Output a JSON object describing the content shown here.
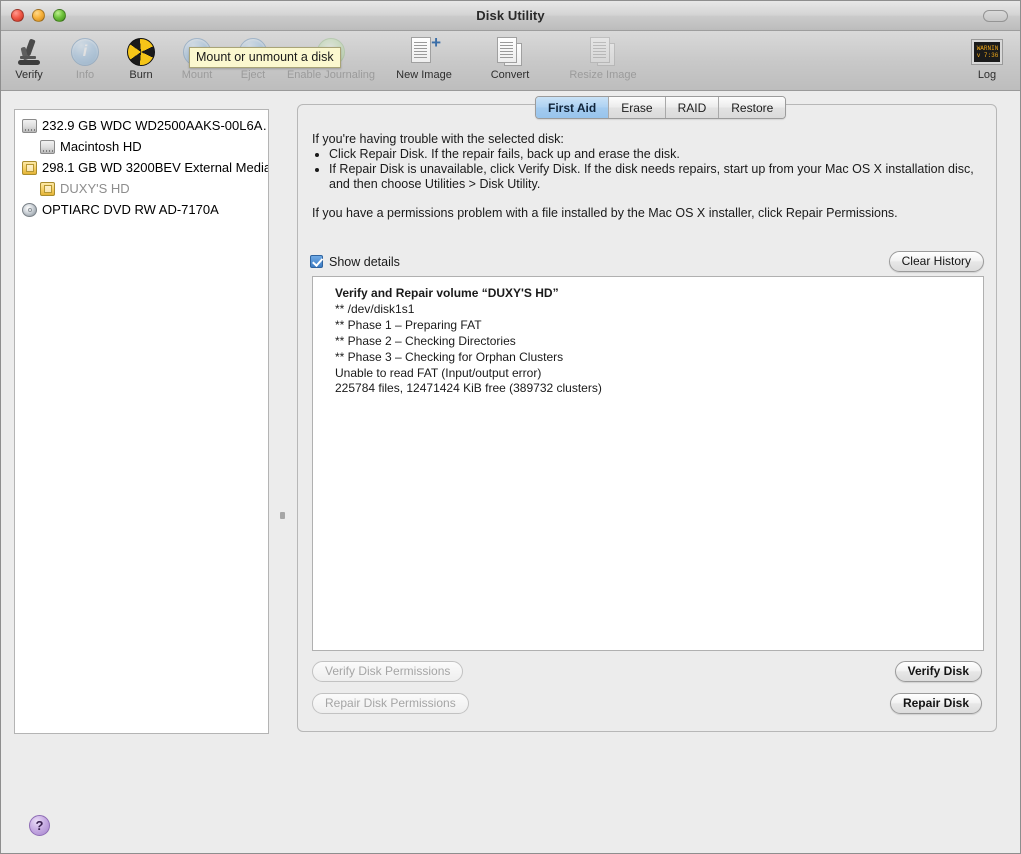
{
  "window": {
    "title": "Disk Utility",
    "traffic_lights": [
      "close",
      "minimize",
      "zoom"
    ]
  },
  "toolbar": {
    "items": [
      {
        "label": "Verify",
        "icon": "microscope-icon",
        "enabled": true
      },
      {
        "label": "Info",
        "icon": "info-icon",
        "enabled": false
      },
      {
        "label": "Burn",
        "icon": "burn-icon",
        "enabled": true
      },
      {
        "label": "Mount",
        "icon": "mount-icon",
        "enabled": false
      },
      {
        "label": "Eject",
        "icon": "eject-icon",
        "enabled": false
      },
      {
        "label": "Enable Journaling",
        "icon": "journaling-icon",
        "enabled": false
      },
      {
        "label": "New Image",
        "icon": "new-image-icon",
        "enabled": true
      },
      {
        "label": "Convert",
        "icon": "convert-icon",
        "enabled": true
      },
      {
        "label": "Resize Image",
        "icon": "resize-image-icon",
        "enabled": false
      }
    ],
    "log_label": "Log",
    "log_icon_text_line1": "WARNIN",
    "log_icon_text_line2": "v 7:36 ",
    "tooltip": "Mount or unmount a disk"
  },
  "sidebar": {
    "items": [
      {
        "label": "232.9 GB WDC WD2500AAKS-00L6A…",
        "icon": "internal-drive-icon",
        "level": 0,
        "dim": false
      },
      {
        "label": "Macintosh HD",
        "icon": "volume-icon",
        "level": 1,
        "dim": false
      },
      {
        "label": "298.1 GB WD 3200BEV External Media",
        "icon": "external-drive-icon",
        "level": 0,
        "dim": false
      },
      {
        "label": "DUXY'S HD",
        "icon": "external-volume-icon",
        "level": 1,
        "dim": true
      },
      {
        "label": "OPTIARC DVD RW AD-7170A",
        "icon": "optical-drive-icon",
        "level": 0,
        "dim": false
      }
    ]
  },
  "panel": {
    "tabs": [
      {
        "label": "First Aid",
        "active": true
      },
      {
        "label": "Erase",
        "active": false
      },
      {
        "label": "RAID",
        "active": false
      },
      {
        "label": "Restore",
        "active": false
      }
    ],
    "instructions": {
      "intro": "If you're having trouble with the selected disk:",
      "bullets": [
        "Click Repair Disk. If the repair fails, back up and erase the disk.",
        "If Repair Disk is unavailable, click Verify Disk. If the disk needs repairs, start up from your Mac OS X installation disc, and then choose Utilities > Disk Utility."
      ],
      "closing": "If you have a permissions problem with a file installed by the Mac OS X installer, click Repair Permissions."
    },
    "show_details_label": "Show details",
    "show_details_checked": true,
    "clear_history_label": "Clear History",
    "log_lines": [
      {
        "text": "Verify and Repair volume “DUXY'S HD”",
        "bold": true
      },
      {
        "text": "** /dev/disk1s1",
        "bold": false
      },
      {
        "text": "** Phase 1 – Preparing FAT",
        "bold": false
      },
      {
        "text": "** Phase 2 – Checking Directories",
        "bold": false
      },
      {
        "text": "** Phase 3 – Checking for Orphan Clusters",
        "bold": false
      },
      {
        "text": "Unable to read FAT (Input/output error)",
        "bold": false
      },
      {
        "text": "225784 files, 12471424 KiB free (389732 clusters)",
        "bold": false
      }
    ],
    "buttons": {
      "verify_permissions": {
        "label": "Verify Disk Permissions",
        "enabled": false
      },
      "repair_permissions": {
        "label": "Repair Disk Permissions",
        "enabled": false
      },
      "verify_disk": {
        "label": "Verify Disk",
        "enabled": true
      },
      "repair_disk": {
        "label": "Repair Disk",
        "enabled": true
      }
    }
  },
  "help": {
    "label": "?"
  }
}
